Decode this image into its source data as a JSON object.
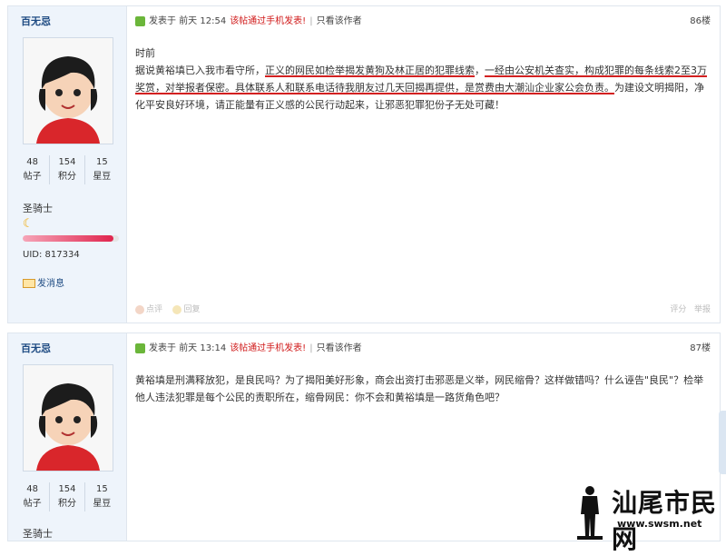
{
  "posts": [
    {
      "username": "百无忌",
      "header": {
        "prefix": "发表于",
        "time": "前天 12:54",
        "mobile_note": "该帖通过手机发表!",
        "sep": "|",
        "author_only": "只看该作者",
        "floor": "86楼"
      },
      "body_line1": "时前",
      "body": [
        {
          "text": "据说黄裕填已入我市看守所，",
          "hl": false
        },
        {
          "text": "正义的网民如检举揭发黄狗及林正居的犯罪线索",
          "hl": true
        },
        {
          "text": "，",
          "hl": false
        },
        {
          "text": "一经由公安机关查实，构成犯罪的每条线索2至3万奖赏，对举报者保密。",
          "hl": true
        },
        {
          "text": "具体联系人和联系电话待我朋友过几天回揭再提供，是赏费由大潮汕企业家公会负责。",
          "hl": true
        },
        {
          "text": "为建设文明揭阳，净化平安良好环境，请正能量有正义感的公民行动起来，让邪恶犯罪犯份子无处可藏！",
          "hl": false
        }
      ],
      "stats": [
        {
          "value": "48",
          "label": "帖子"
        },
        {
          "value": "154",
          "label": "积分"
        },
        {
          "value": "15",
          "label": "星豆"
        }
      ],
      "rank": "圣骑士",
      "rank_progress": 0.94,
      "uid": "UID: 817334",
      "send_msg": "发消息",
      "footer": {
        "rate": "点评",
        "reply": "回复",
        "score": "评分",
        "report": "举报"
      }
    },
    {
      "username": "百无忌",
      "header": {
        "prefix": "发表于",
        "time": "前天 13:14",
        "mobile_note": "该帖通过手机发表!",
        "sep": "|",
        "author_only": "只看该作者",
        "floor": "87楼"
      },
      "body_text": "黄裕填是刑满释放犯，是良民吗？为了揭阳美好形象，商会出资打击邪恶是义举，网民缩骨？这样做错吗？什么诬告\"良民\"？检举他人违法犯罪是每个公民的责职所在，缩骨网民：你不会和黄裕填是一路货角色吧？",
      "stats": [
        {
          "value": "48",
          "label": "帖子"
        },
        {
          "value": "154",
          "label": "积分"
        },
        {
          "value": "15",
          "label": "星豆"
        }
      ],
      "rank": "圣骑士"
    }
  ],
  "watermark": {
    "site_name": "汕尾市民网",
    "url": "www.swsm.net"
  }
}
